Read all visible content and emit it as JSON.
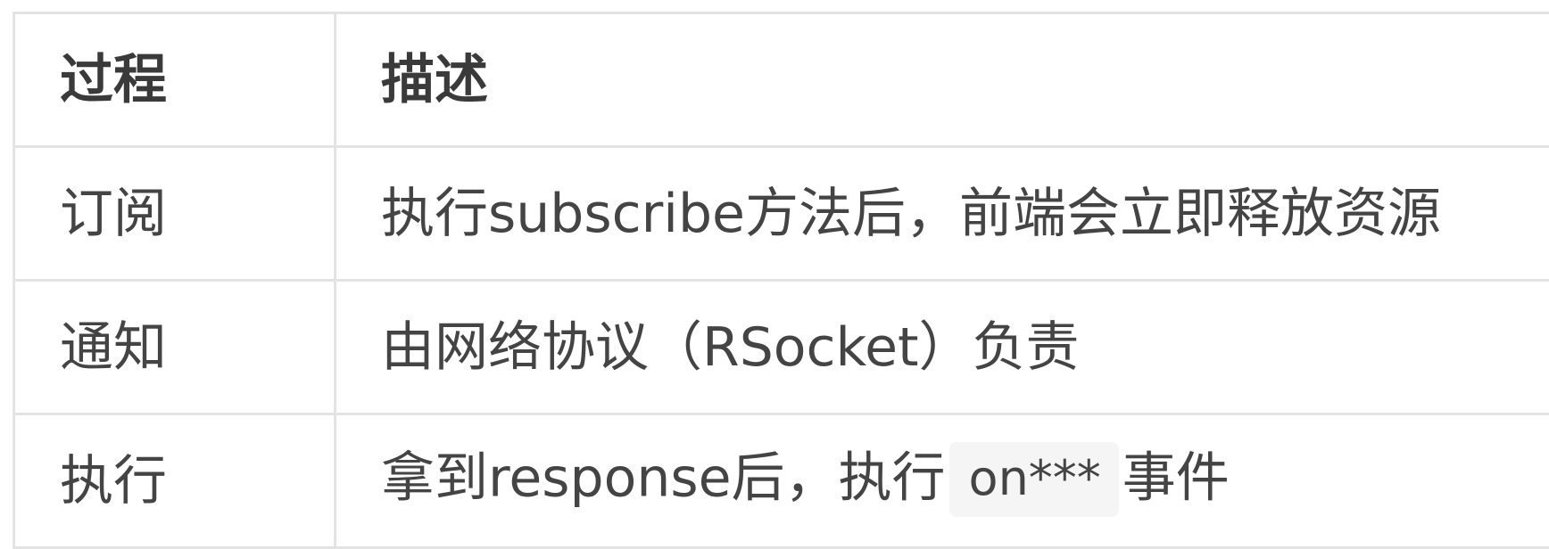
{
  "table": {
    "headers": {
      "process": "过程",
      "description": "描述"
    },
    "rows": [
      {
        "process": "订阅",
        "description": "执行subscribe方法后，前端会立即释放资源"
      },
      {
        "process": "通知",
        "description": "由网络协议（RSocket）负责"
      },
      {
        "process": "执行",
        "description_before": "拿到response后，执行",
        "description_code": "on***",
        "description_after": "事件"
      }
    ]
  }
}
